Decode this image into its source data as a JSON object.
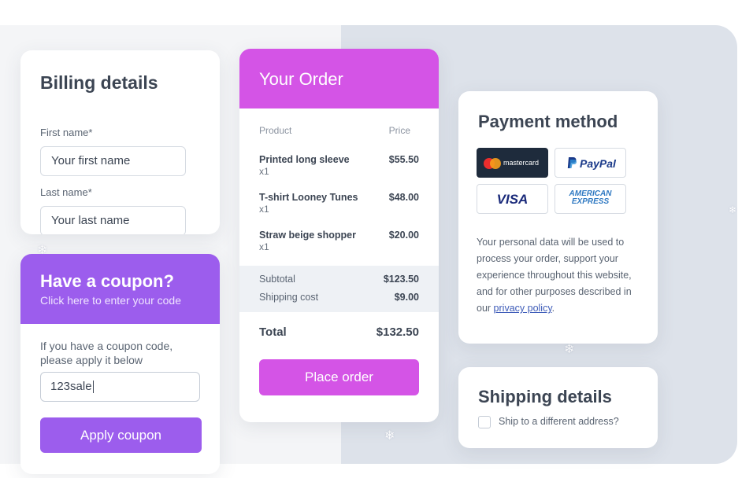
{
  "billing": {
    "title": "Billing details",
    "first_name_label": "First name*",
    "first_name_value": "Your first name",
    "last_name_label": "Last name*",
    "last_name_value": "Your last name"
  },
  "coupon": {
    "title": "Have a coupon?",
    "subtitle": "Click here to enter your code",
    "note": "If you have a coupon code, please apply it below",
    "code_value": "123sale",
    "apply_label": "Apply coupon"
  },
  "order": {
    "title": "Your Order",
    "col_product": "Product",
    "col_price": "Price",
    "items": [
      {
        "name": "Printed long sleeve",
        "qty": "x1",
        "price": "$55.50"
      },
      {
        "name": "T-shirt Looney Tunes",
        "qty": "x1",
        "price": "$48.00"
      },
      {
        "name": "Straw beige shopper",
        "qty": "x1",
        "price": "$20.00"
      }
    ],
    "subtotal_label": "Subtotal",
    "subtotal_value": "$123.50",
    "shipping_label": "Shipping cost",
    "shipping_value": "$9.00",
    "total_label": "Total",
    "total_value": "$132.50",
    "place_label": "Place order"
  },
  "payment": {
    "title": "Payment method",
    "methods": {
      "mastercard": "mastercard",
      "paypal": "PayPal",
      "visa": "VISA",
      "amex_line1": "AMERICAN",
      "amex_line2": "EXPRESS"
    },
    "privacy_text": "Your personal data will be used to process your order, support your experience throughout this website, and for other purposes described in our ",
    "privacy_link": "privacy policy",
    "privacy_end": "."
  },
  "shipping": {
    "title": "Shipping details",
    "checkbox_label": "Ship to a different address?"
  },
  "colors": {
    "order_accent": "#d454e6",
    "coupon_accent": "#9c5ded",
    "right_bg": "#dde2ea",
    "left_bg": "#f4f5f7"
  },
  "icons": [
    "snowflake-icon",
    "mastercard-logo-icon",
    "paypal-logo-icon",
    "visa-logo-icon",
    "amex-logo-icon",
    "checkbox-icon"
  ]
}
